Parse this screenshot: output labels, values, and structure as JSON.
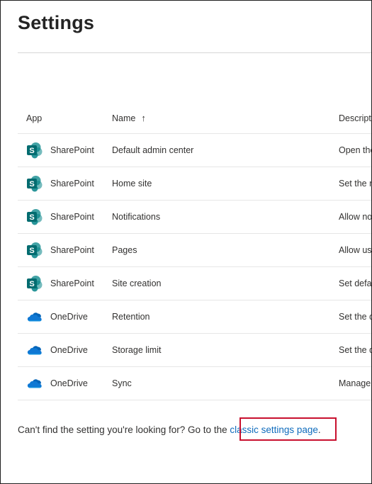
{
  "page": {
    "title": "Settings"
  },
  "table": {
    "headers": {
      "app": "App",
      "name": "Name",
      "sort_indicator": "↑",
      "description": "Descripti"
    },
    "rows": [
      {
        "app": "SharePoint",
        "icon": "sharepoint-icon",
        "name": "Default admin center",
        "description": "Open the"
      },
      {
        "app": "SharePoint",
        "icon": "sharepoint-icon",
        "name": "Home site",
        "description": "Set the m"
      },
      {
        "app": "SharePoint",
        "icon": "sharepoint-icon",
        "name": "Notifications",
        "description": "Allow no"
      },
      {
        "app": "SharePoint",
        "icon": "sharepoint-icon",
        "name": "Pages",
        "description": "Allow use"
      },
      {
        "app": "SharePoint",
        "icon": "sharepoint-icon",
        "name": "Site creation",
        "description": "Set defau"
      },
      {
        "app": "OneDrive",
        "icon": "onedrive-icon",
        "name": "Retention",
        "description": "Set the d"
      },
      {
        "app": "OneDrive",
        "icon": "onedrive-icon",
        "name": "Storage limit",
        "description": "Set the d"
      },
      {
        "app": "OneDrive",
        "icon": "onedrive-icon",
        "name": "Sync",
        "description": "Manage"
      }
    ]
  },
  "footer": {
    "text": "Can't find the setting you're looking for? Go to the ",
    "link_label": "classic settings page",
    "suffix": "."
  },
  "colors": {
    "sharepoint": "#038387",
    "onedrive": "#0f78d4",
    "link": "#0f6cbd",
    "highlight": "#c8102e"
  }
}
